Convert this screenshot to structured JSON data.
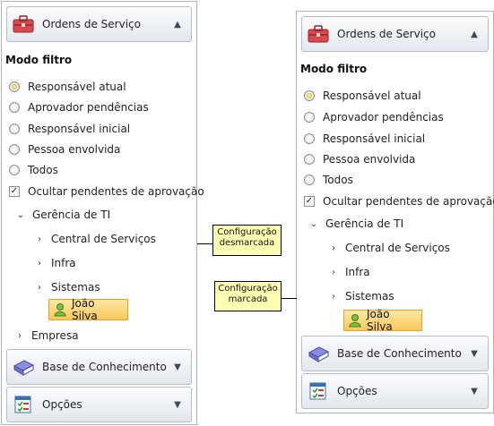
{
  "panel_left": {
    "orders_header": "Ordens de Serviço",
    "mode_title": "Modo filtro",
    "radios": [
      "Responsável atual",
      "Aprovador pendências",
      "Responsável inicial",
      "Pessoa envolvida",
      "Todos"
    ],
    "checkbox_label": "Ocultar pendentes de aprovação",
    "tree": {
      "root": "Gerência de TI",
      "children": [
        "Central de Serviços",
        "Infra",
        "Sistemas"
      ],
      "selected_user": "João Silva",
      "sibling": "Empresa"
    },
    "knowledge_header": "Base de Conhecimento",
    "options_header": "Opções"
  },
  "panel_right": {
    "orders_header": "Ordens de Serviço",
    "mode_title": "Modo filtro",
    "radios": [
      "Responsável atual",
      "Aprovador pendências",
      "Responsável inicial",
      "Pessoa envolvida",
      "Todos"
    ],
    "checkbox_label": "Ocultar pendentes de aprovação",
    "tree": {
      "root": "Gerência de TI",
      "children": [
        "Central de Serviços",
        "Infra",
        "Sistemas"
      ],
      "selected_user": "João Silva"
    },
    "knowledge_header": "Base de Conhecimento",
    "options_header": "Opções"
  },
  "callouts": {
    "unchecked": [
      "Configuração",
      "desmarcada"
    ],
    "checked": [
      "Configuração",
      "marcada"
    ]
  },
  "icons": {
    "orders": "toolbox-icon",
    "knowledge": "book-icon",
    "options": "checklist-icon",
    "user": "user-icon"
  },
  "colors": {
    "selected_background": "#fbd06b",
    "selected_border": "#e3a528",
    "radio_checked": "#e0a400",
    "callout_background": "#ffffb4"
  },
  "state": {
    "selected_radio": "Responsável atual",
    "hide_pending_approval_checked": true
  }
}
